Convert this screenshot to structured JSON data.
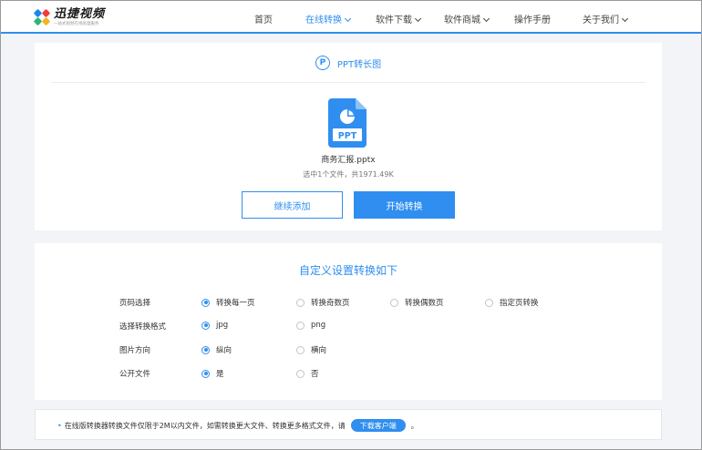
{
  "brand": {
    "name": "迅捷视频",
    "tagline": "一站式视频在线处理服务",
    "colors": {
      "accent": "#2f8ef0",
      "text": "#333333",
      "background": "#f3f4f7"
    }
  },
  "nav": {
    "items": [
      {
        "label": "首页"
      },
      {
        "label": "在线转换"
      },
      {
        "label": "软件下载"
      },
      {
        "label": "软件商城"
      },
      {
        "label": "操作手册"
      },
      {
        "label": "关于我们"
      }
    ]
  },
  "upload": {
    "tool_icon_letter": "P",
    "tool_title": "PPT转长图",
    "file_badge": "PPT",
    "file_name": "商务汇报.pptx",
    "file_info": "选中1个文件，共1971.49K",
    "continue_label": "继续添加",
    "start_label": "开始转换"
  },
  "settings": {
    "title": "自定义设置转换如下",
    "rows": [
      {
        "label": "页码选择",
        "options": [
          "转换每一页",
          "转换奇数页",
          "转换偶数页",
          "指定页转换"
        ],
        "selected": 0
      },
      {
        "label": "选择转换格式",
        "options": [
          "jpg",
          "png"
        ],
        "selected": 0
      },
      {
        "label": "图片方向",
        "options": [
          "纵向",
          "横向"
        ],
        "selected": 0
      },
      {
        "label": "公开文件",
        "options": [
          "是",
          "否"
        ],
        "selected": 0
      }
    ]
  },
  "notice": {
    "bullet": "•",
    "text": "在线版转换器转换文件仅限于2M以内文件，如需转换更大文件、转换更多格式文件，请",
    "download_label": "下载客户端",
    "end": "。"
  }
}
